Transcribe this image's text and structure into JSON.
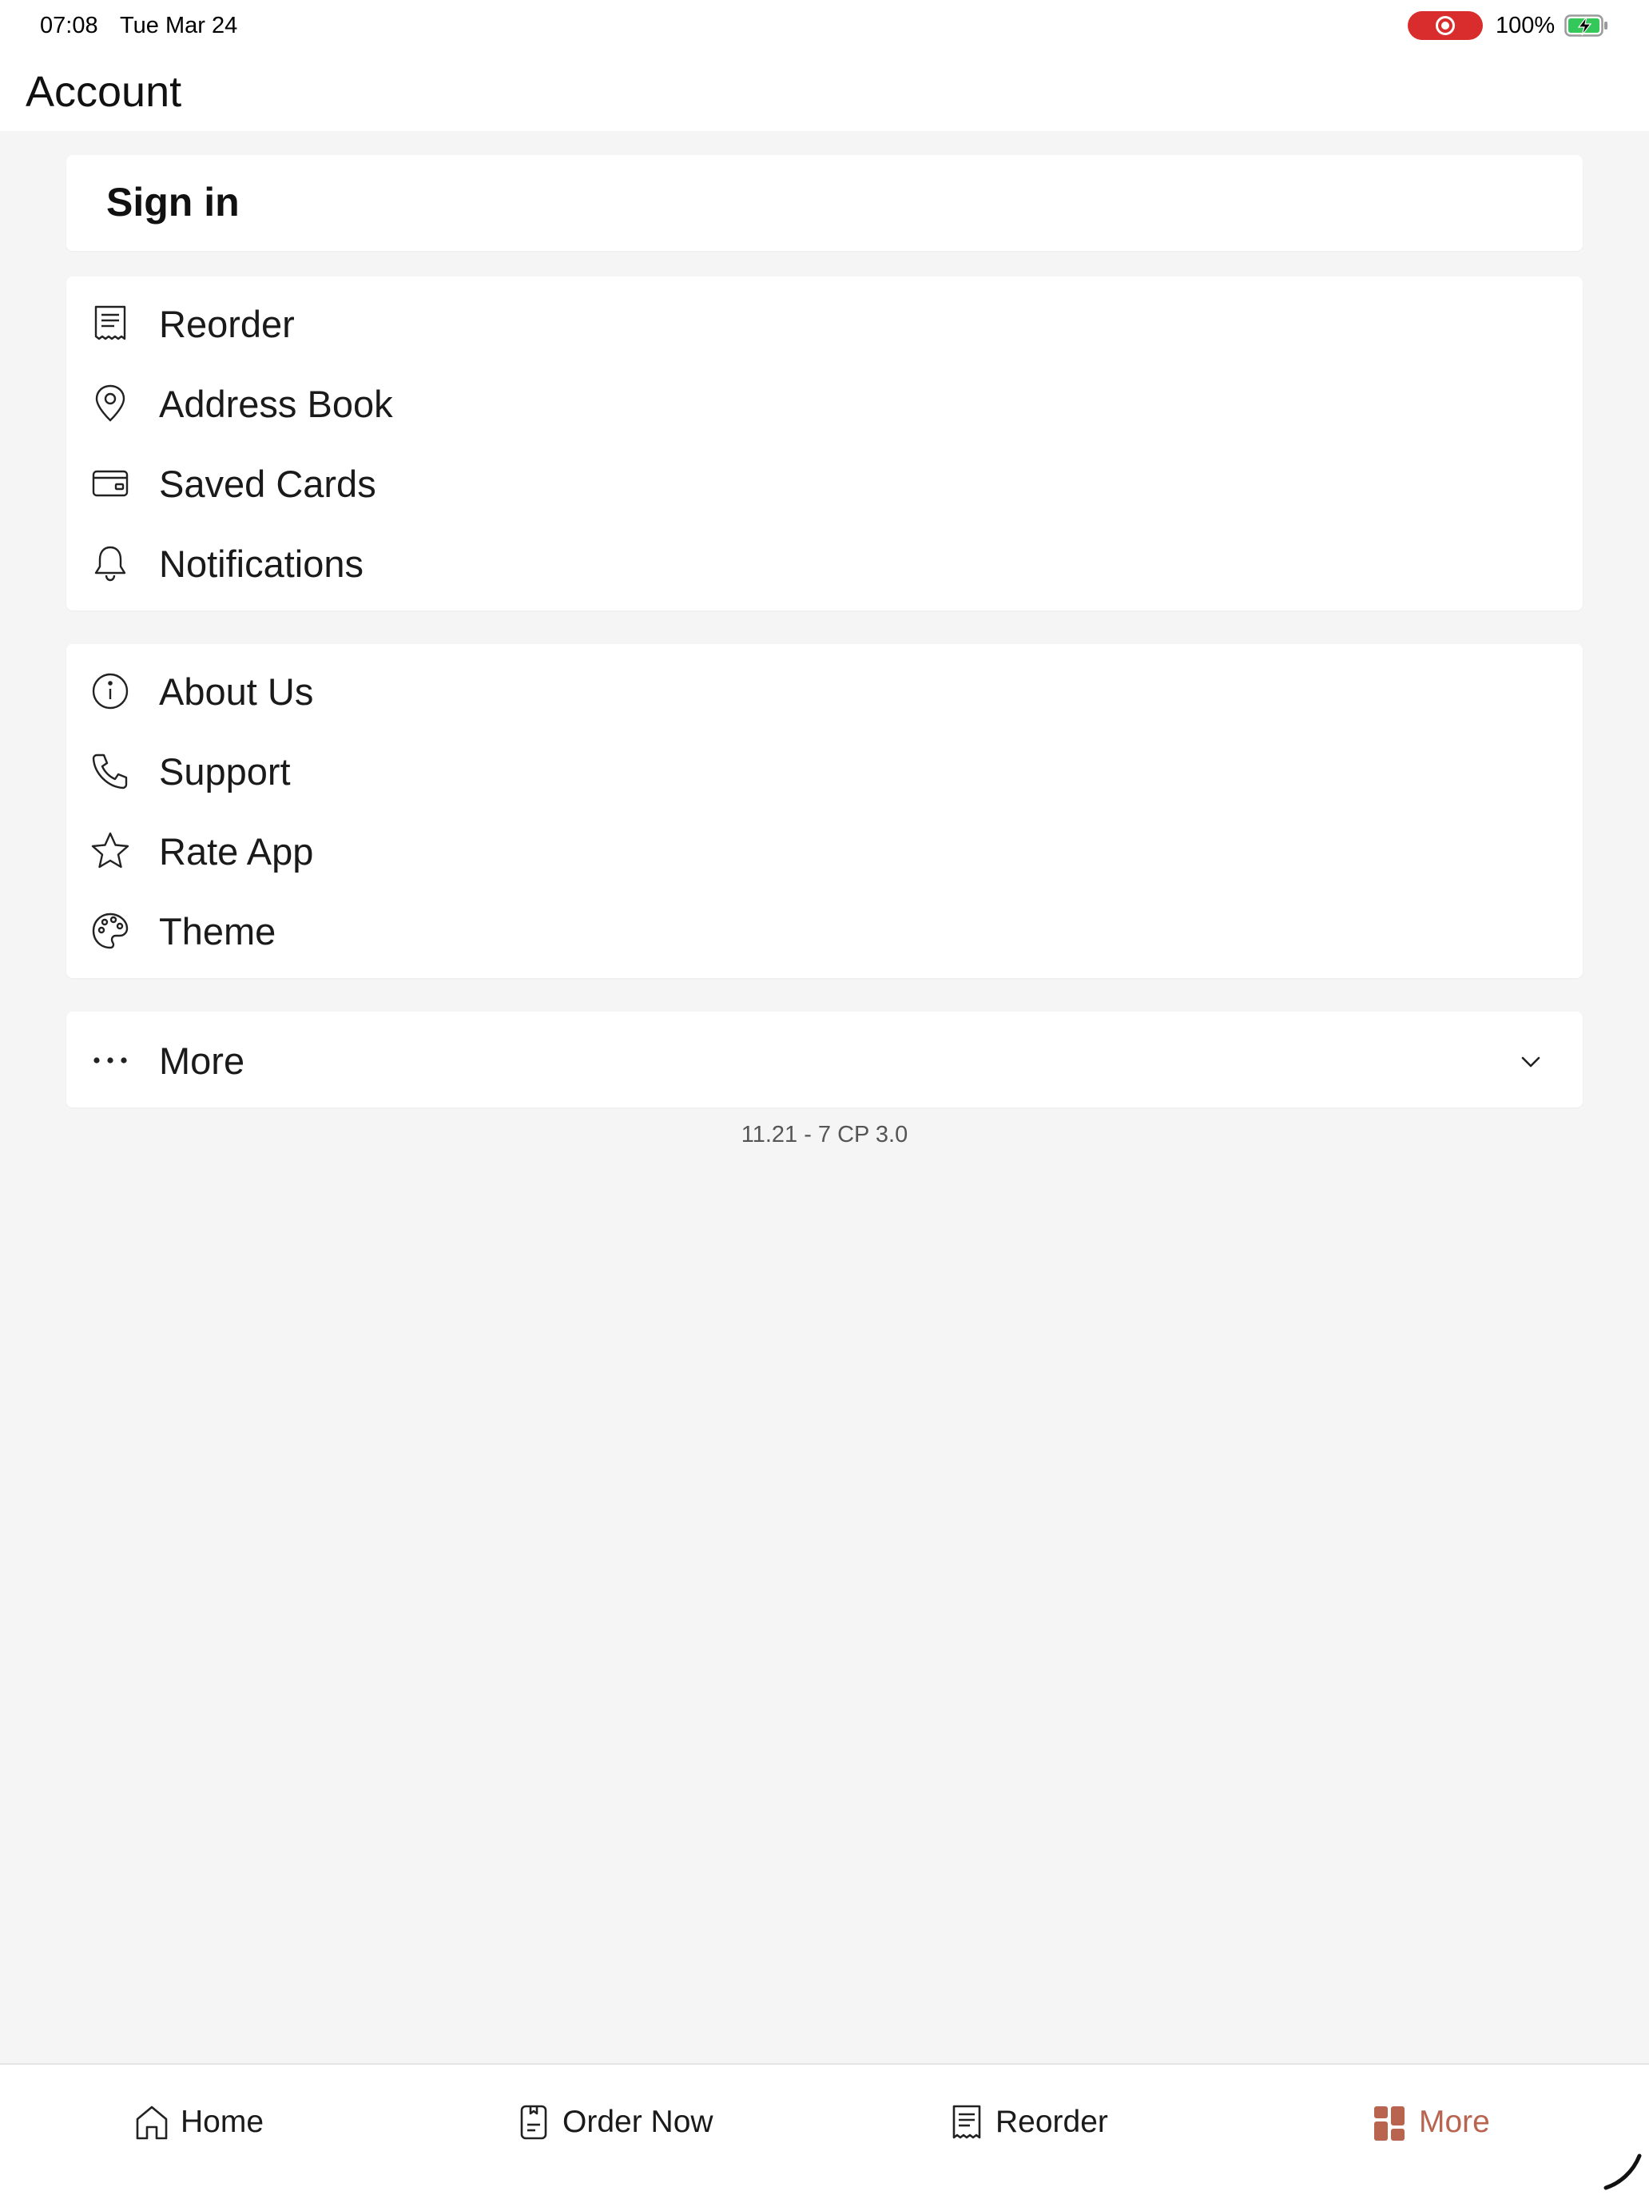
{
  "status_bar": {
    "time": "07:08",
    "date": "Tue Mar 24",
    "battery": "100%"
  },
  "header": {
    "title": "Account"
  },
  "signin": {
    "label": "Sign in"
  },
  "menu_group_1": [
    {
      "label": "Reorder",
      "icon": "receipt-icon"
    },
    {
      "label": "Address Book",
      "icon": "map-pin-icon"
    },
    {
      "label": "Saved Cards",
      "icon": "wallet-icon"
    },
    {
      "label": "Notifications",
      "icon": "bell-icon"
    }
  ],
  "menu_group_2": [
    {
      "label": "About Us",
      "icon": "info-icon"
    },
    {
      "label": "Support",
      "icon": "phone-icon"
    },
    {
      "label": "Rate App",
      "icon": "star-icon"
    },
    {
      "label": "Theme",
      "icon": "palette-icon"
    }
  ],
  "more_section": {
    "label": "More",
    "icon": "ellipsis-icon"
  },
  "version": "11.21 - 7 CP 3.0",
  "tab_bar": {
    "tabs": [
      {
        "label": "Home",
        "icon": "home-icon"
      },
      {
        "label": "Order Now",
        "icon": "order-icon"
      },
      {
        "label": "Reorder",
        "icon": "receipt-icon"
      },
      {
        "label": "More",
        "icon": "grid-icon"
      }
    ],
    "active_tab": "More"
  },
  "colors": {
    "accent": "#b8644f",
    "record": "#d92d2d",
    "battery": "#34c759",
    "background": "#f5f5f5"
  }
}
